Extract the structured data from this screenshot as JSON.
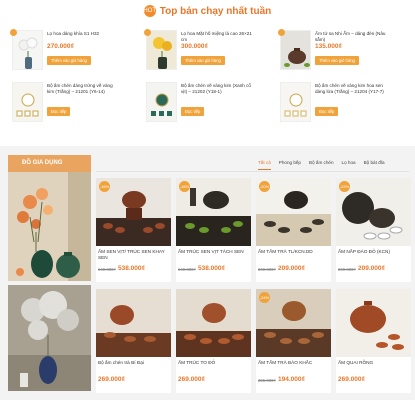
{
  "header": {
    "badge_text": "HOT",
    "title": "Top bán chạy nhất tuần"
  },
  "top_products": [
    {
      "name": "Lọ hoa dáng khía S1 H32",
      "old": "",
      "price": "270.000₫",
      "button": "Thêm vào giỏ hàng"
    },
    {
      "name": "Lọ hoa Mặt hố miệng lá cao 26×21 cm",
      "old": "",
      "price": "300.000₫",
      "button": "Thêm vào giỏ hàng"
    },
    {
      "name": "Ấm tử sa Nhi Ẩm – dáng đèn (Nâu sẫm)",
      "old": "",
      "price": "135.000₫",
      "button": "Thêm vào giỏ hàng"
    },
    {
      "name": "Bộ ấm chén dáng trứng vẽ vàng kim (Trắng) – 21201 (Y6-14)",
      "old": "",
      "price": "",
      "button": "Đọc tiếp"
    },
    {
      "name": "Bộ ấm chén vẽ vàng kim (Xanh cổ vịt) – 21202 (Y18-1)",
      "old": "",
      "price": "",
      "button": "Đọc tiếp"
    },
    {
      "name": "Bộ ấm chén vẽ vàng kim hoa sen dáng lửa (Trắng) – 21204 (Y17-7)",
      "old": "",
      "price": "",
      "button": "Đọc tiếp"
    }
  ],
  "section": {
    "title": "ĐỒ GIA DỤNG",
    "tabs": [
      "Tất cả",
      "Phong bếp",
      "Bộ ấm chén",
      "Lọ hoa",
      "Bộ bát đĩa"
    ]
  },
  "products": [
    {
      "sale": "-16%",
      "name": "ẤM SEN VỊT/ TRÚC SEN KHAY SEN",
      "old": "640.000₫",
      "price": "538.000₫"
    },
    {
      "sale": "-16%",
      "name": "ẤM TRÚC SEN VỊT TÁCH SEN",
      "old": "640.000₫",
      "price": "538.000₫"
    },
    {
      "sale": "-20%",
      "name": "ẤM TẤM TRÀ TL/KCN.DD",
      "old": "260.000₫",
      "price": "209.000₫"
    },
    {
      "sale": "-22%",
      "name": "ẤM NẮP ĐÀO ĐỎ (KCN)",
      "old": "269.000₫",
      "price": "209.000₫"
    },
    {
      "sale": "",
      "name": "Bộ ấm chén trà Bí Đại",
      "old": "",
      "price": "269.000₫"
    },
    {
      "sale": "",
      "name": "ẤM TRÚC TO ĐỎ",
      "old": "",
      "price": "269.000₫"
    },
    {
      "sale": "-24%",
      "name": "ẤM TẤM TRÀ BÀO KHẮC",
      "old": "255.000₫",
      "price": "194.000₫"
    },
    {
      "sale": "",
      "name": "ẤM QUAI RỒNG",
      "old": "",
      "price": "269.000₫"
    }
  ]
}
